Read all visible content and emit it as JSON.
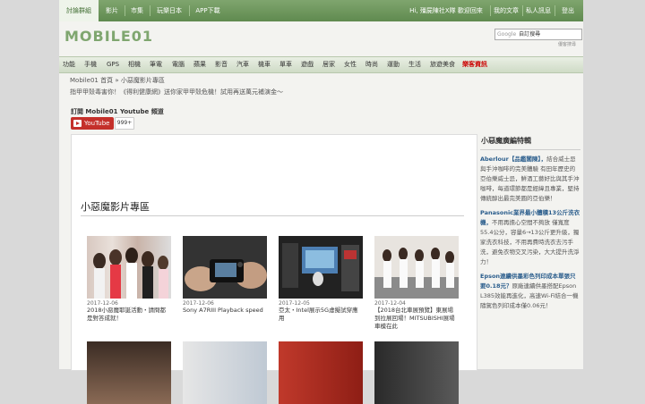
{
  "topnav": {
    "left": [
      "討論群組",
      "影片",
      "市集",
      "玩樂日本",
      "APP下載"
    ],
    "right": [
      "Hi, 殭屍陳社X隊 歡迎回來",
      "我的文章",
      "私人訊息",
      "登出"
    ]
  },
  "logo": {
    "text": "MOBILE01"
  },
  "search": {
    "prefix": "Google",
    "value": "自訂搜尋",
    "hint": "優客搜尋"
  },
  "categories": [
    {
      "label": "功能"
    },
    {
      "label": "手機"
    },
    {
      "label": "GPS"
    },
    {
      "label": "相機"
    },
    {
      "label": "筆電"
    },
    {
      "label": "電腦"
    },
    {
      "label": "蘋果"
    },
    {
      "label": "影音"
    },
    {
      "label": "汽車"
    },
    {
      "label": "機車"
    },
    {
      "label": "單車"
    },
    {
      "label": "遊戲"
    },
    {
      "label": "居家"
    },
    {
      "label": "女性"
    },
    {
      "label": "時尚"
    },
    {
      "label": "運動"
    },
    {
      "label": "生活"
    },
    {
      "label": "旅遊美食"
    },
    {
      "label": "樂客資訊",
      "highlight": true
    }
  ],
  "breadcrumb": "Mobile01 首頁 » 小惡魔影片專區",
  "tagline": "指甲甲殼毒害你！《得利健康網》送你家甲甲殼危機！試用再送萬元補演金～",
  "youtube": {
    "label": "訂閱 Mobile01 Youtube 頻道",
    "button": "YouTube",
    "count": "999+"
  },
  "section_title": "小惡魔影片專區",
  "videos": [
    {
      "date": "2017-12-06",
      "title": "2018小惡魔耶誕活動・請問都是對答成就！"
    },
    {
      "date": "2017-12-06",
      "title": "Sony A7RIII Playback speed"
    },
    {
      "date": "2017-12-05",
      "title": "亞太・Intel展示5G虛擬試穿應用"
    },
    {
      "date": "2017-12-04",
      "title": "【2018台北車展預覽】東展場到拉展回場！MITSUBISHI展場車模在此"
    }
  ],
  "sidebar": {
    "heading": "小惡魔廣編特輯",
    "items": [
      {
        "title": "Aberlour【品鑑閣陳】，",
        "body": "結合威士忌與手沖咖啡的完美體驗 有田年歷史的亞伯樂威士忌，鮮酒工藝好比與其手沖咖啡，每道環節都是經緯且專業，堅持傳統醇出最完美圓的亞伯樂！"
      },
      {
        "title": "Panasonic業界最小體積13公斤洗衣機，",
        "body": "不用再擔心空間不夠放 僅寬度55.4公分，容量6→13公斤更升級，獨家洗衣科技，不用再費時洗衣去污手洗，避免衣物交叉污染，大大提升洗淨力！"
      },
      {
        "title": "Epson連續供墨彩色列印成本單張只要0.18元？",
        "body": "原廠連續供墨搭配Epson L385效能再進化，高速Wi-Fi結合一機隨駕色列印成本僅0.06元！"
      }
    ]
  }
}
